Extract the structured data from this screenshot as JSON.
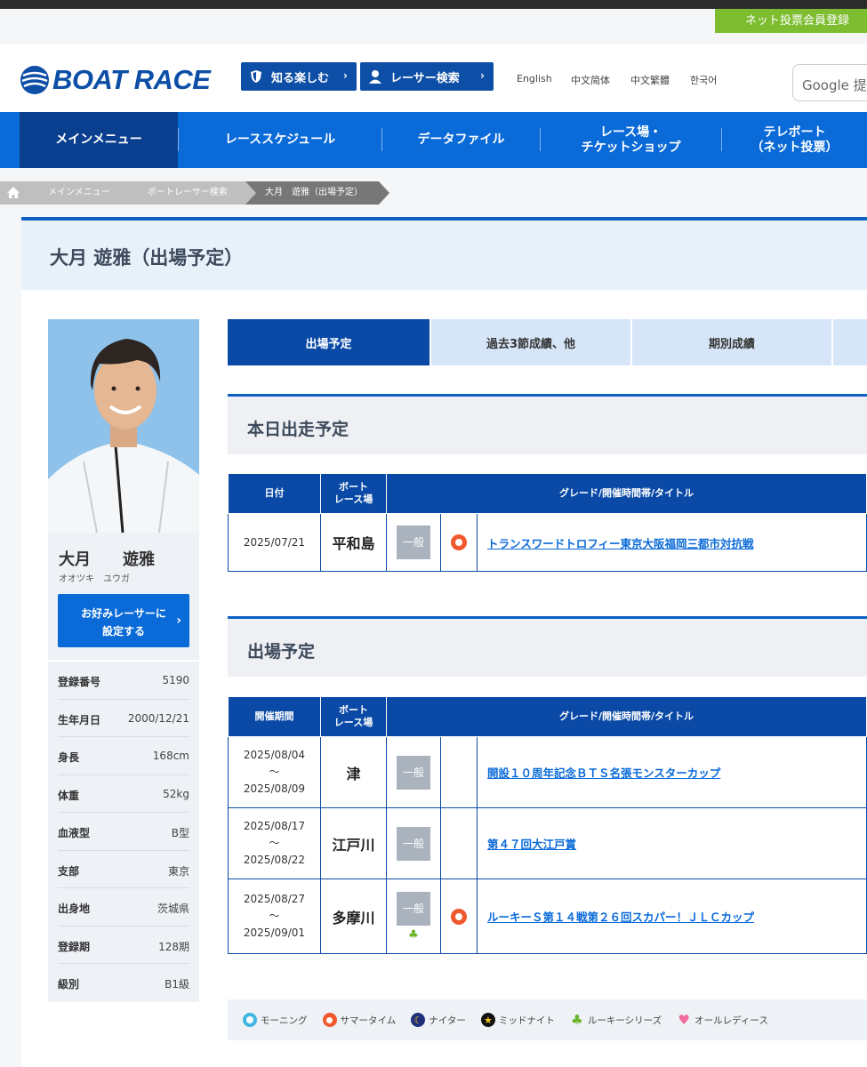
{
  "header": {
    "member_button": "ネット投票会員登録",
    "logo_text": "BOAT RACE",
    "btn_shiru": "知る楽しむ",
    "btn_racer_search": "レーサー検索",
    "languages": [
      "English",
      "中文简体",
      "中文繁體",
      "한국어"
    ],
    "search_placeholder": "Google 提供"
  },
  "nav": {
    "items": [
      "メインメニュー",
      "レーススケジュール",
      "データファイル",
      "レース場・\nチケットショップ",
      "テレボート\n（ネット投票）"
    ]
  },
  "breadcrumb": [
    "メインメニュー",
    "ボートレーサー検索",
    "大月　遊雅（出場予定）"
  ],
  "page_title": "大月 遊雅（出場予定）",
  "racer": {
    "name": "大月　　遊雅",
    "kana": "オオツキ　ユウガ",
    "fav_button": "お好みレーサーに\n設定する",
    "profile": [
      {
        "label": "登録番号",
        "value": "5190"
      },
      {
        "label": "生年月日",
        "value": "2000/12/21"
      },
      {
        "label": "身長",
        "value": "168cm"
      },
      {
        "label": "体重",
        "value": "52kg"
      },
      {
        "label": "血液型",
        "value": "B型"
      },
      {
        "label": "支部",
        "value": "東京"
      },
      {
        "label": "出身地",
        "value": "茨城県"
      },
      {
        "label": "登録期",
        "value": "128期"
      },
      {
        "label": "級別",
        "value": "B1級"
      }
    ]
  },
  "tabs": [
    "出場予定",
    "過去3節成績、他",
    "期別成績"
  ],
  "today": {
    "heading": "本日出走予定",
    "columns": [
      "日付",
      "ボート\nレース場",
      "グレード/開催時間帯/タイトル"
    ],
    "rows": [
      {
        "date": "2025/07/21",
        "venue": "平和島",
        "grade": "一般",
        "title": "トランスワードトロフィー東京大阪福岡三都市対抗戦"
      }
    ]
  },
  "schedule": {
    "heading": "出場予定",
    "columns": [
      "開催期間",
      "ボート\nレース場",
      "グレード/開催時間帯/タイトル"
    ],
    "rows": [
      {
        "start": "2025/08/04",
        "tilde": "～",
        "end": "2025/08/09",
        "venue": "津",
        "grade": "一般",
        "title": "開設１０周年記念ＢＴＳ名張モンスターカップ"
      },
      {
        "start": "2025/08/17",
        "tilde": "～",
        "end": "2025/08/22",
        "venue": "江戸川",
        "grade": "一般",
        "title": "第４７回大江戸賞"
      },
      {
        "start": "2025/08/27",
        "tilde": "～",
        "end": "2025/09/01",
        "venue": "多摩川",
        "grade": "一般",
        "title": "ルーキーＳ第１４戦第２６回スカパー！ＪＬＣカップ"
      }
    ]
  },
  "legend": [
    "モーニング",
    "サマータイム",
    "ナイター",
    "ミッドナイト",
    "ルーキーシリーズ",
    "オールレディース"
  ]
}
